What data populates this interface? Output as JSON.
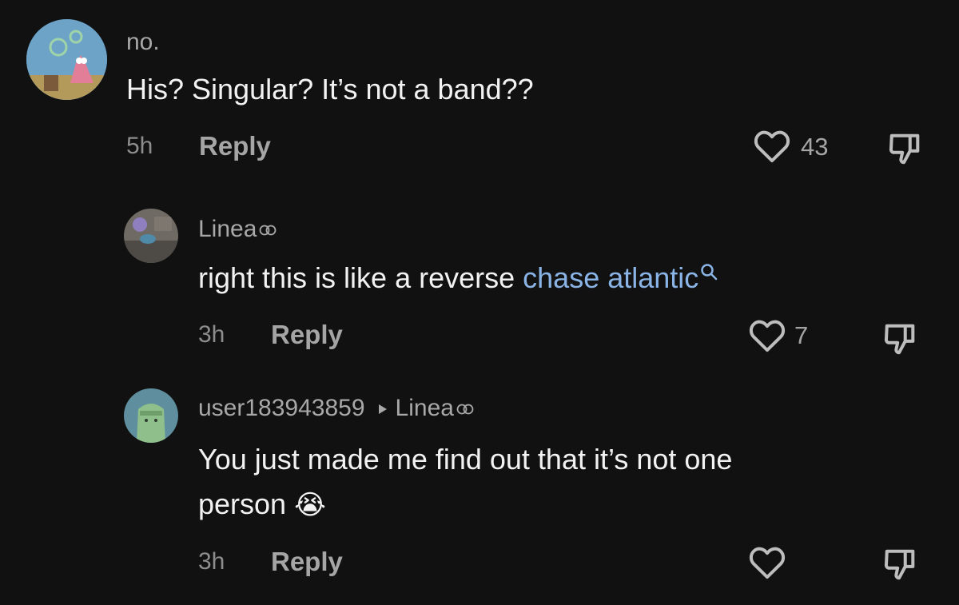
{
  "colors": {
    "background": "#111111",
    "text": "#f2f2f2",
    "muted": "#a5a5a5",
    "link": "#8ab4e6"
  },
  "comments": [
    {
      "username": "no.",
      "text": "His? Singular? It’s not a band??",
      "time": "5h",
      "reply_label": "Reply",
      "likes": "43",
      "avatar_icon": "starfish-cartoon-avatar"
    },
    {
      "username": "Linea",
      "text_before": "right this is like a reverse ",
      "search_link": "chase atlantic",
      "time": "3h",
      "reply_label": "Reply",
      "likes": "7",
      "avatar_icon": "photo-avatar"
    },
    {
      "username": "user183943859",
      "reply_to": "Linea",
      "text_line1": "You just made me find out that it’s not one",
      "text_line2": "person",
      "emoji": "😭",
      "time": "3h",
      "reply_label": "Reply",
      "likes": "",
      "avatar_icon": "green-cartoon-avatar"
    }
  ]
}
